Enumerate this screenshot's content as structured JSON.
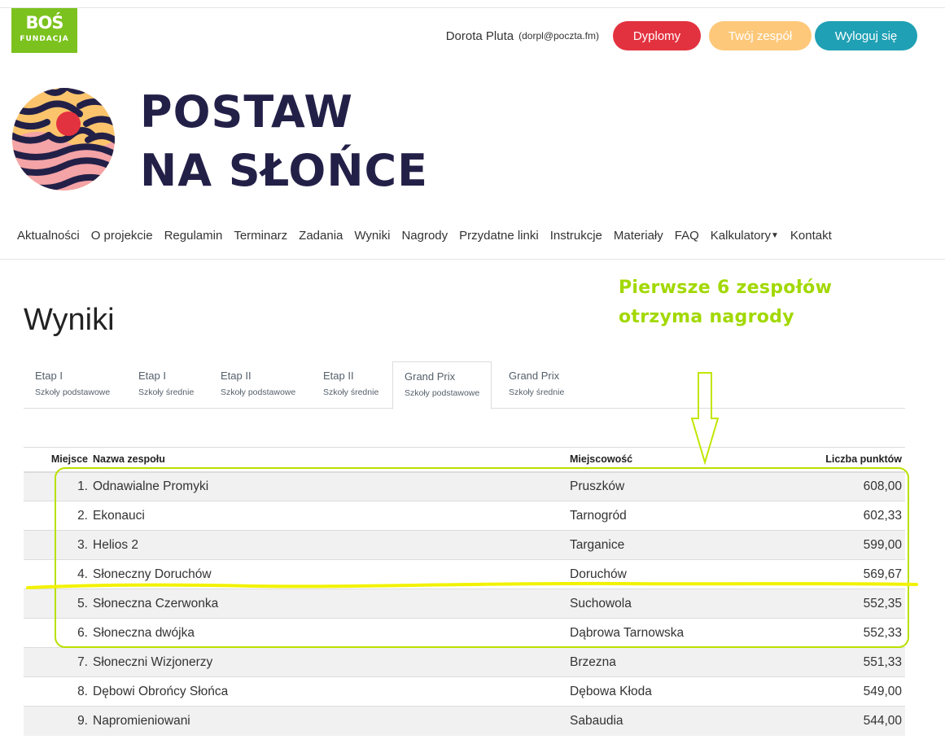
{
  "brand": {
    "bos_logo_main": "BOŚ",
    "bos_logo_sub": "FUNDACJA",
    "site_title_line1": "POSTAW",
    "site_title_line2": "NA SŁOŃCE"
  },
  "user": {
    "name": "Dorota Pluta",
    "email": "(dorpl@poczta.fm)"
  },
  "buttons": {
    "diplomas": "Dyplomy",
    "team": "Twój zespół",
    "logout": "Wyloguj się"
  },
  "nav": {
    "items": [
      "Aktualności",
      "O projekcie",
      "Regulamin",
      "Terminarz",
      "Zadania",
      "Wyniki",
      "Nagrody",
      "Przydatne linki",
      "Instrukcje",
      "Materiały",
      "FAQ",
      "Kalkulatory",
      "Kontakt"
    ]
  },
  "annotation": {
    "line1": "Pierwsze 6 zespołów",
    "line2": "otrzyma nagrody"
  },
  "page": {
    "title": "Wyniki"
  },
  "tabs": [
    {
      "title": "Etap I",
      "subtitle": "Szkoły podstawowe"
    },
    {
      "title": "Etap I",
      "subtitle": "Szkoły średnie"
    },
    {
      "title": "Etap II",
      "subtitle": "Szkoły podstawowe"
    },
    {
      "title": "Etap II",
      "subtitle": "Szkoły średnie"
    },
    {
      "title": "Grand Prix",
      "subtitle": "Szkoły podstawowe"
    },
    {
      "title": "Grand Prix",
      "subtitle": "Szkoły średnie"
    }
  ],
  "active_tab": "Grand Prix — Szkoły podstawowe",
  "table": {
    "headers": {
      "place": "Miejsce",
      "name": "Nazwa zespołu",
      "city": "Miejscowość",
      "points": "Liczba punktów"
    },
    "rows": [
      {
        "place": "1.",
        "name": "Odnawialne Promyki",
        "city": "Pruszków",
        "points": "608,00"
      },
      {
        "place": "2.",
        "name": "Ekonauci",
        "city": "Tarnogród",
        "points": "602,33"
      },
      {
        "place": "3.",
        "name": "Helios 2",
        "city": "Targanice",
        "points": "599,00"
      },
      {
        "place": "4.",
        "name": "Słoneczny Doruchów",
        "city": "Doruchów",
        "points": "569,67"
      },
      {
        "place": "5.",
        "name": "Słoneczna Czerwonka",
        "city": "Suchowola",
        "points": "552,35"
      },
      {
        "place": "6.",
        "name": "Słoneczna dwójka",
        "city": "Dąbrowa Tarnowska",
        "points": "552,33"
      },
      {
        "place": "7.",
        "name": "Słoneczni Wizjonerzy",
        "city": "Brzezna",
        "points": "551,33"
      },
      {
        "place": "8.",
        "name": "Dębowi Obrońcy Słońca",
        "city": "Dębowa Kłoda",
        "points": "549,00"
      },
      {
        "place": "9.",
        "name": "Napromieniowani",
        "city": "Sabaudia",
        "points": "544,00"
      }
    ]
  },
  "colors": {
    "brand_green": "#7cc21e",
    "title_navy": "#232048",
    "diplomas_red": "#e3323f",
    "team_orange": "#fdc87a",
    "logout_teal": "#1fa0b4",
    "annotation_green": "#a2d800",
    "highlight_yellow": "#f2f200"
  },
  "icons": {
    "dropdown": "caret-down-icon",
    "annotation_arrow": "arrow-down-icon",
    "logo": "sun-logo-icon"
  }
}
